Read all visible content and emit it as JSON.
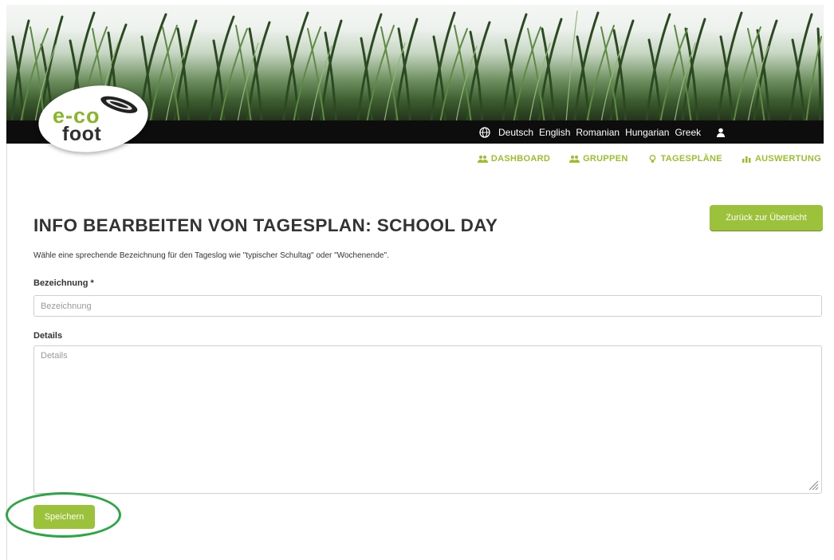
{
  "header": {
    "logo": {
      "line1": "e-co",
      "line2": "foot"
    },
    "languages": [
      "Deutsch",
      "English",
      "Romanian",
      "Hungarian",
      "Greek"
    ]
  },
  "nav": {
    "items": [
      {
        "label": "DASHBOARD",
        "icon": "users-icon"
      },
      {
        "label": "GRUPPEN",
        "icon": "users-icon"
      },
      {
        "label": "TAGESPLÄNE",
        "icon": "bulb-icon"
      },
      {
        "label": "AUSWERTUNG",
        "icon": "chart-icon"
      }
    ]
  },
  "page": {
    "title": "INFO BEARBEITEN VON TAGESPLAN: SCHOOL DAY",
    "back_button": "Zurück zur Übersicht",
    "hint": "Wähle eine sprechende Bezeichnung für den Tageslog wie \"typischer Schultag\" oder \"Wochenende\"."
  },
  "form": {
    "name_label": "Bezeichnung *",
    "name_placeholder": "Bezeichnung",
    "details_label": "Details",
    "details_placeholder": "Details",
    "save_button": "Speichern"
  },
  "colors": {
    "accent": "#9cc13a",
    "nav_text": "#9bbf2e",
    "header_strip": "#0d0d0d",
    "highlight_ring": "#2aa742"
  }
}
